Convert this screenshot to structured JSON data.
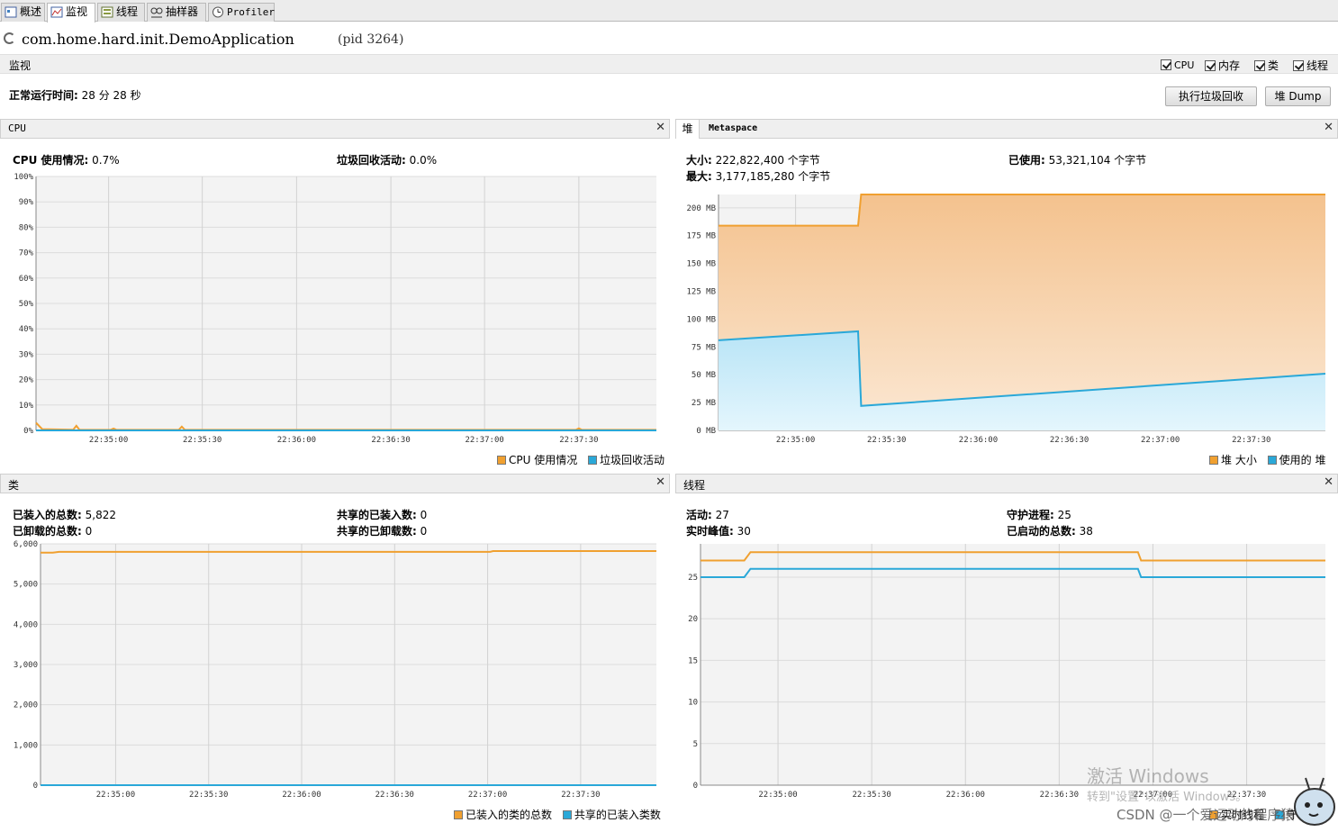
{
  "tabs": [
    {
      "label": "概述"
    },
    {
      "label": "监视"
    },
    {
      "label": "线程"
    },
    {
      "label": "抽样器"
    },
    {
      "label": "Profiler"
    }
  ],
  "app": {
    "name": "com.home.hard.init.DemoApplication",
    "pid": "(pid 3264)"
  },
  "monitor": {
    "title": "监视",
    "checks": [
      "CPU",
      "内存",
      "类",
      "线程"
    ],
    "uptime_label": "正常运行时间:",
    "uptime_value": "28 分 28 秒",
    "gc_button": "执行垃圾回收",
    "heapdump_button": "堆 Dump"
  },
  "cpu_panel": {
    "tab": "CPU",
    "usage_label": "CPU 使用情况:",
    "usage_value": "0.7%",
    "gc_label": "垃圾回收活动:",
    "gc_value": "0.0%",
    "legend": [
      "CPU 使用情况",
      "垃圾回收活动"
    ]
  },
  "heap_panel": {
    "tab_heap": "堆",
    "tab_meta": "Metaspace",
    "size_label": "大小:",
    "size_value": "222,822,400 个字节",
    "max_label": "最大:",
    "max_value": "3,177,185,280 个字节",
    "used_label": "已使用:",
    "used_value": "53,321,104 个字节",
    "legend": [
      "堆 大小",
      "使用的 堆"
    ]
  },
  "classes_panel": {
    "tab": "类",
    "loaded_label": "已装入的总数:",
    "loaded_value": "5,822",
    "unloaded_label": "已卸载的总数:",
    "unloaded_value": "0",
    "shared_loaded_label": "共享的已装入数:",
    "shared_loaded_value": "0",
    "shared_unloaded_label": "共享的已卸载数:",
    "shared_unloaded_value": "0",
    "legend": [
      "已装入的类的总数",
      "共享的已装入类数"
    ]
  },
  "threads_panel": {
    "tab": "线程",
    "live_label": "活动:",
    "live_value": "27",
    "peak_label": "实时峰值:",
    "peak_value": "30",
    "daemon_label": "守护进程:",
    "daemon_value": "25",
    "started_label": "已启动的总数:",
    "started_value": "38",
    "legend": [
      "实时线程",
      "守"
    ]
  },
  "watermark": {
    "line1": "激活 Windows",
    "line2": "转到\"设置\"以激活 Windows。",
    "csdn": "CSDN @一个爱运动的程序猿"
  },
  "colors": {
    "orange": "#f0a030",
    "blue": "#2aa8d8",
    "orange_fill": "#f6c894",
    "blue_fill": "#c6ecf8"
  },
  "chart_data": [
    {
      "type": "line",
      "name": "cpu",
      "x": [
        "22:34:40",
        "22:35:00",
        "22:35:30",
        "22:36:00",
        "22:36:30",
        "22:37:00",
        "22:37:30",
        "22:37:55"
      ],
      "xticks": [
        "22:35:00",
        "22:35:30",
        "22:36:00",
        "22:36:30",
        "22:37:00",
        "22:37:30"
      ],
      "yticks": [
        "0%",
        "10%",
        "20%",
        "30%",
        "40%",
        "50%",
        "60%",
        "70%",
        "80%",
        "90%",
        "100%"
      ],
      "ylim": [
        0,
        100
      ],
      "series": [
        {
          "name": "CPU 使用情况",
          "color": "#f0a030",
          "points": [
            [
              0,
              3
            ],
            [
              0.01,
              0.5
            ],
            [
              0.06,
              0.3
            ],
            [
              0.065,
              1.8
            ],
            [
              0.07,
              0.3
            ],
            [
              0.12,
              0.2
            ],
            [
              0.125,
              0.7
            ],
            [
              0.13,
              0.2
            ],
            [
              0.23,
              0.2
            ],
            [
              0.235,
              1.5
            ],
            [
              0.24,
              0.2
            ],
            [
              0.87,
              0.2
            ],
            [
              0.875,
              0.8
            ],
            [
              0.88,
              0.2
            ],
            [
              1,
              0.2
            ]
          ]
        },
        {
          "name": "垃圾回收活动",
          "color": "#2aa8d8",
          "points": [
            [
              0,
              0
            ],
            [
              1,
              0
            ]
          ]
        }
      ]
    },
    {
      "type": "area",
      "name": "heap",
      "xticks": [
        "22:35:00",
        "22:35:30",
        "22:36:00",
        "22:36:30",
        "22:37:00",
        "22:37:30"
      ],
      "yticks": [
        "0 MB",
        "25 MB",
        "50 MB",
        "75 MB",
        "100 MB",
        "125 MB",
        "150 MB",
        "175 MB",
        "200 MB"
      ],
      "ylim": [
        0,
        212
      ],
      "series": [
        {
          "name": "堆 大小",
          "color": "#f0a030",
          "points": [
            [
              0,
              184
            ],
            [
              0.23,
              184
            ],
            [
              0.235,
              212
            ],
            [
              1,
              212
            ]
          ]
        },
        {
          "name": "使用的 堆",
          "color": "#2aa8d8",
          "points": [
            [
              0,
              81
            ],
            [
              0.23,
              89
            ],
            [
              0.235,
              22
            ],
            [
              1,
              51
            ]
          ]
        }
      ]
    },
    {
      "type": "line",
      "name": "classes",
      "xticks": [
        "22:35:00",
        "22:35:30",
        "22:36:00",
        "22:36:30",
        "22:37:00",
        "22:37:30"
      ],
      "yticks": [
        "0",
        "1,000",
        "2,000",
        "3,000",
        "4,000",
        "5,000",
        "6,000"
      ],
      "ylim": [
        0,
        6000
      ],
      "series": [
        {
          "name": "已装入的类的总数",
          "color": "#f0a030",
          "points": [
            [
              0,
              5780
            ],
            [
              0.02,
              5780
            ],
            [
              0.03,
              5800
            ],
            [
              0.73,
              5800
            ],
            [
              0.735,
              5822
            ],
            [
              1,
              5822
            ]
          ]
        },
        {
          "name": "共享的已装入类数",
          "color": "#2aa8d8",
          "points": [
            [
              0,
              0
            ],
            [
              1,
              0
            ]
          ]
        }
      ]
    },
    {
      "type": "line",
      "name": "threads",
      "xticks": [
        "22:35:00",
        "22:35:30",
        "22:36:00",
        "22:36:30",
        "22:37:00",
        "22:37:30"
      ],
      "yticks": [
        "0",
        "5",
        "10",
        "15",
        "20",
        "25"
      ],
      "ylim": [
        0,
        29
      ],
      "series": [
        {
          "name": "实时线程",
          "color": "#f0a030",
          "points": [
            [
              0,
              27
            ],
            [
              0.07,
              27
            ],
            [
              0.08,
              28
            ],
            [
              0.7,
              28
            ],
            [
              0.705,
              27
            ],
            [
              1,
              27
            ]
          ]
        },
        {
          "name": "守",
          "color": "#2aa8d8",
          "points": [
            [
              0,
              25
            ],
            [
              0.07,
              25
            ],
            [
              0.08,
              26
            ],
            [
              0.7,
              26
            ],
            [
              0.705,
              25
            ],
            [
              1,
              25
            ]
          ]
        }
      ]
    }
  ]
}
